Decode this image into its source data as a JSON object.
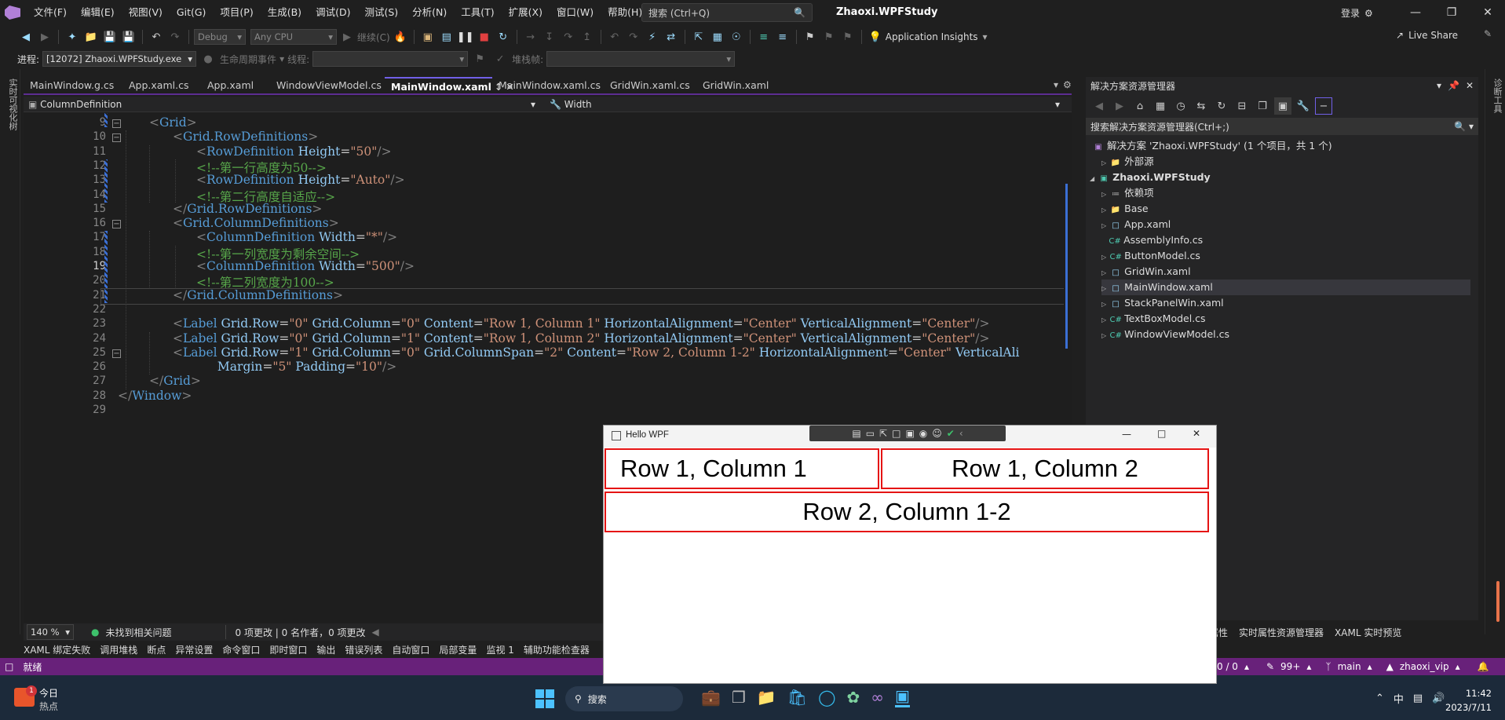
{
  "menu": [
    "文件(F)",
    "编辑(E)",
    "视图(V)",
    "Git(G)",
    "项目(P)",
    "生成(B)",
    "调试(D)",
    "测试(S)",
    "分析(N)",
    "工具(T)",
    "扩展(X)",
    "窗口(W)",
    "帮助(H)"
  ],
  "search": {
    "placeholder": "搜索 (Ctrl+Q)"
  },
  "app_title": "Zhaoxi.WPFStudy",
  "login": "登录",
  "toolbar": {
    "config": "Debug",
    "platform": "Any CPU",
    "continue": "继续(C)",
    "insights": "Application Insights",
    "live_share": "Live Share"
  },
  "toolbar2": {
    "process_label": "进程:",
    "process": "[12072] Zhaoxi.WPFStudy.exe",
    "lifecycle": "生命周期事件",
    "thread_label": "线程:",
    "stack_label": "堆栈帧:"
  },
  "left_strip": "实时可视化树",
  "right_strip": "诊断工具",
  "tabs": [
    {
      "label": "MainWindow.g.cs",
      "active": false
    },
    {
      "label": "App.xaml.cs",
      "active": false
    },
    {
      "label": "App.xaml",
      "active": false
    },
    {
      "label": "WindowViewModel.cs",
      "active": false
    },
    {
      "label": "MainWindow.xaml",
      "active": true
    },
    {
      "label": "MainWindow.xaml.cs",
      "active": false
    },
    {
      "label": "GridWin.xaml.cs",
      "active": false
    },
    {
      "label": "GridWin.xaml",
      "active": false
    }
  ],
  "nav": {
    "left": "ColumnDefinition",
    "right": "Width"
  },
  "line_numbers": [
    "9",
    "10",
    "11",
    "12",
    "13",
    "14",
    "15",
    "16",
    "17",
    "18",
    "19",
    "20",
    "21",
    "22",
    "23",
    "24",
    "25",
    "26",
    "27",
    "28",
    "29"
  ],
  "current_line": "19",
  "code": {
    "l9": [
      "<",
      "Grid",
      ">"
    ],
    "l10": [
      "<",
      "Grid.RowDefinitions",
      ">"
    ],
    "l11": [
      "<",
      "RowDefinition",
      " Height",
      "=",
      "\"50\"",
      "/>"
    ],
    "l12": "<!--第一行高度为50-->",
    "l13": [
      "<",
      "RowDefinition",
      " Height",
      "=",
      "\"Auto\"",
      "/>"
    ],
    "l14": "<!--第二行高度自适应-->",
    "l15": [
      "</",
      "Grid.RowDefinitions",
      ">"
    ],
    "l16": [
      "<",
      "Grid.ColumnDefinitions",
      ">"
    ],
    "l17": [
      "<",
      "ColumnDefinition",
      " Width",
      "=",
      "\"*\"",
      "/>"
    ],
    "l18": "<!--第一列宽度为剩余空间-->",
    "l19": [
      "<",
      "ColumnDefinition",
      " Width",
      "=",
      "\"500\"",
      "/>"
    ],
    "l20": "<!--第二列宽度为100-->",
    "l21": [
      "</",
      "Grid.ColumnDefinitions",
      ">"
    ],
    "l23": [
      "<",
      "Label",
      " Grid.Row",
      "=",
      "\"0\"",
      " Grid.Column",
      "=",
      "\"0\"",
      " Content",
      "=",
      "\"Row 1, Column 1\"",
      " HorizontalAlignment",
      "=",
      "\"Center\"",
      " VerticalAlignment",
      "=",
      "\"Center\"",
      "/>"
    ],
    "l24": [
      "<",
      "Label",
      " Grid.Row",
      "=",
      "\"0\"",
      " Grid.Column",
      "=",
      "\"1\"",
      " Content",
      "=",
      "\"Row 1, Column 2\"",
      " HorizontalAlignment",
      "=",
      "\"Center\"",
      " VerticalAlignment",
      "=",
      "\"Center\"",
      "/>"
    ],
    "l25": [
      "<",
      "Label",
      " Grid.Row",
      "=",
      "\"1\"",
      " Grid.Column",
      "=",
      "\"0\"",
      " Grid.ColumnSpan",
      "=",
      "\"2\"",
      " Content",
      "=",
      "\"Row 2, Column 1-2\"",
      " HorizontalAlignment",
      "=",
      "\"Center\"",
      " VerticalAli"
    ],
    "l26": [
      " Margin",
      "=",
      "\"5\"",
      " Padding",
      "=",
      "\"10\"",
      "/>"
    ],
    "l27": [
      "</",
      "Grid",
      ">"
    ],
    "l28": [
      "</",
      "Window",
      ">"
    ]
  },
  "solution": {
    "header": "解决方案资源管理器",
    "search": "搜索解决方案资源管理器(Ctrl+;)",
    "root": "解决方案 'Zhaoxi.WPFStudy' (1 个项目，共 1 个)",
    "items": [
      {
        "label": "外部源",
        "icon": "folder-icon"
      },
      {
        "label": "Zhaoxi.WPFStudy",
        "icon": "project-icon",
        "bold": true
      },
      {
        "label": "依赖项",
        "icon": "dependencies-icon"
      },
      {
        "label": "Base",
        "icon": "folder-icon"
      },
      {
        "label": "App.xaml",
        "icon": "xaml-icon"
      },
      {
        "label": "AssemblyInfo.cs",
        "icon": "csharp-icon"
      },
      {
        "label": "ButtonModel.cs",
        "icon": "csharp-icon"
      },
      {
        "label": "GridWin.xaml",
        "icon": "xaml-icon"
      },
      {
        "label": "MainWindow.xaml",
        "icon": "xaml-icon",
        "selected": true
      },
      {
        "label": "StackPanelWin.xaml",
        "icon": "xaml-icon"
      },
      {
        "label": "TextBoxModel.cs",
        "icon": "csharp-icon"
      },
      {
        "label": "WindowViewModel.cs",
        "icon": "csharp-icon"
      }
    ]
  },
  "status": {
    "zoom": "140 %",
    "issues": "未找到相关问题",
    "changes": "0 项更改 | 0 名作者，0 项更改"
  },
  "solution_tabs": [
    "属性",
    "实时属性资源管理器",
    "XAML 实时预览"
  ],
  "bottom_tabs": [
    "XAML 绑定失败",
    "调用堆栈",
    "断点",
    "异常设置",
    "命令窗口",
    "即时窗口",
    "输出",
    "错误列表",
    "自动窗口",
    "局部变量",
    "监视 1",
    "辅助功能检查器"
  ],
  "statusbar": {
    "ready": "就绪",
    "errors": "0 / 0",
    "commits": "99+",
    "branch": "main",
    "user": "zhaoxi_vip"
  },
  "taskbar": {
    "widget_title": "今日",
    "widget_sub": "热点",
    "search": "搜索",
    "badge": "1",
    "ime": "中",
    "time": "11:42",
    "date": "2023/7/11"
  },
  "wpf": {
    "title": "Hello WPF",
    "labels": [
      "Row 1, Column 1",
      "Row 1, Column 2",
      "Row 2, Column 1-2"
    ]
  },
  "colors": {
    "accent": "#68217a",
    "label_border": "#e51414",
    "xml_element": "#569cd6",
    "xml_attr": "#92caf4",
    "xml_string": "#ce9178",
    "xml_comment": "#57a64a"
  }
}
